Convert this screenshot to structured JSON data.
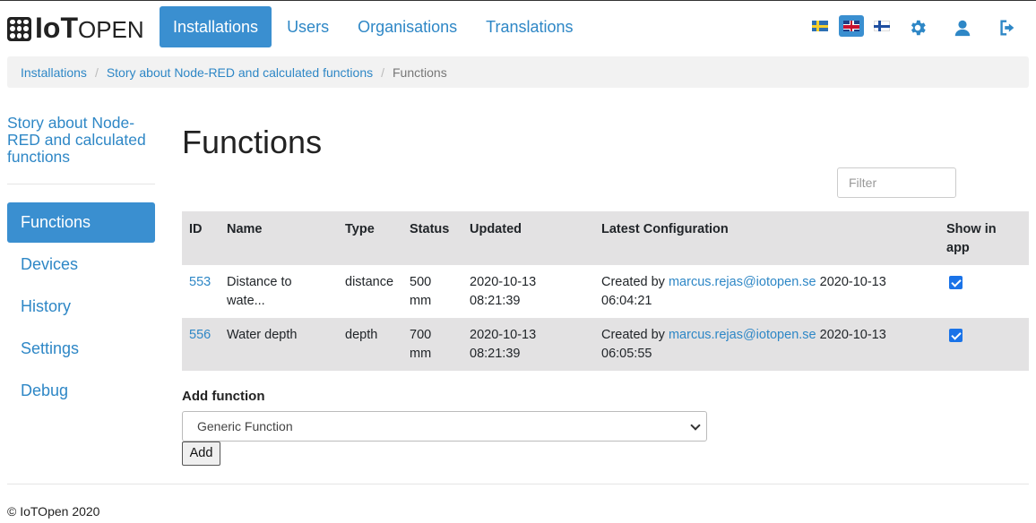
{
  "navbar": {
    "logo_text": {
      "bold": "IoT",
      "thin": "OPEN"
    },
    "links": [
      {
        "label": "Installations",
        "active": true
      },
      {
        "label": "Users",
        "active": false
      },
      {
        "label": "Organisations",
        "active": false
      },
      {
        "label": "Translations",
        "active": false
      }
    ],
    "languages": [
      "swedish-flag",
      "english-flag",
      "finnish-flag"
    ],
    "active_language": "english-flag",
    "icons": [
      "gear-icon",
      "user-icon",
      "logout-icon"
    ]
  },
  "breadcrumb": {
    "items": [
      "Installations",
      "Story about Node-RED and calculated functions"
    ],
    "current": "Functions"
  },
  "sidebar": {
    "title": "Story about Node-RED and calculated functions",
    "items": [
      {
        "label": "Functions",
        "active": true
      },
      {
        "label": "Devices",
        "active": false
      },
      {
        "label": "History",
        "active": false
      },
      {
        "label": "Settings",
        "active": false
      },
      {
        "label": "Debug",
        "active": false
      }
    ]
  },
  "main": {
    "title": "Functions",
    "filter_placeholder": "Filter",
    "table": {
      "headers": {
        "id": "ID",
        "name": "Name",
        "type": "Type",
        "status": "Status",
        "updated": "Updated",
        "latest": "Latest Configuration",
        "show": "Show in app"
      },
      "rows": [
        {
          "id": "553",
          "name": "Distance to wate...",
          "type": "distance",
          "status": "500 mm",
          "updated": "2020-10-13 08:21:39",
          "created_prefix": "Created by",
          "created_by": "marcus.rejas@iotopen.se",
          "created_at": "2020-10-13 06:04:21",
          "show_in_app": true
        },
        {
          "id": "556",
          "name": "Water depth",
          "type": "depth",
          "status": "700 mm",
          "updated": "2020-10-13 08:21:39",
          "created_prefix": "Created by",
          "created_by": "marcus.rejas@iotopen.se",
          "created_at": "2020-10-13 06:05:55",
          "show_in_app": true
        }
      ]
    },
    "add_function": {
      "label": "Add function",
      "selected": "Generic Function",
      "button": "Add"
    }
  },
  "footer": {
    "text": "© IoTOpen 2020"
  },
  "colors": {
    "accent": "#3a8fd0",
    "link": "#2e87c6",
    "table_header": "#e3e2e3"
  }
}
